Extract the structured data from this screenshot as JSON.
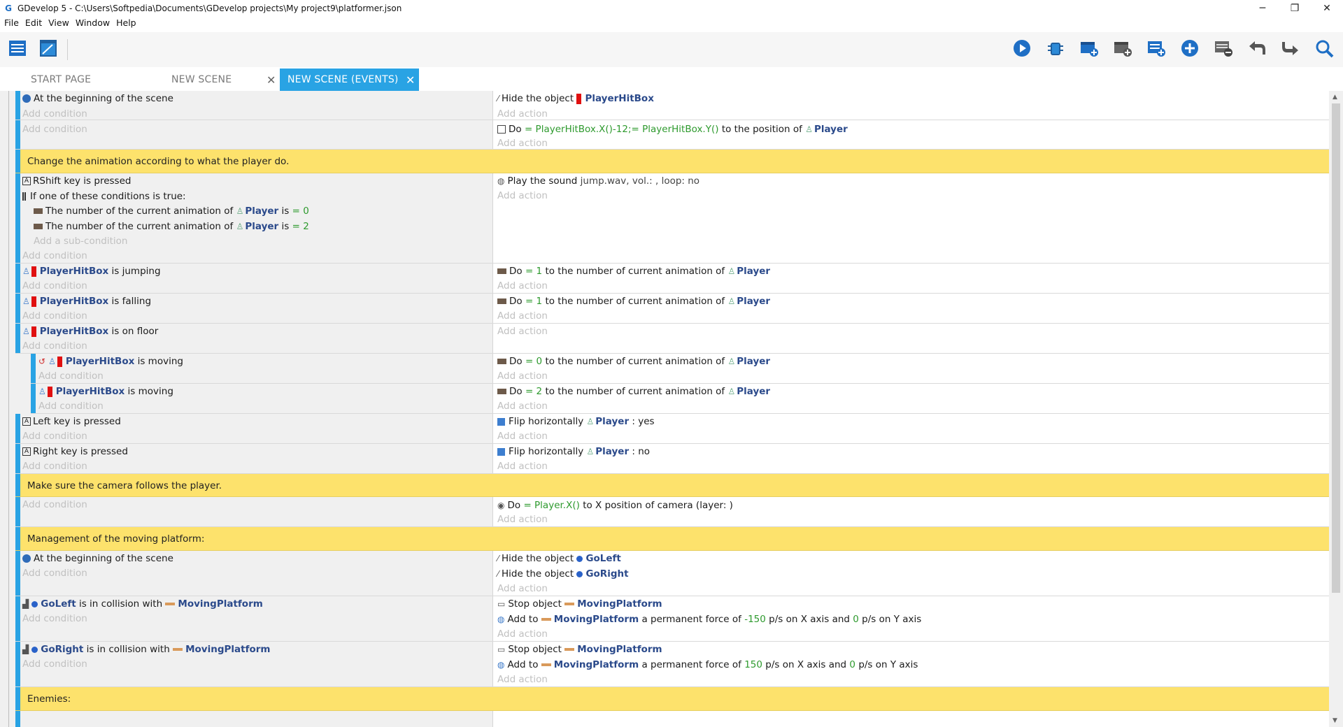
{
  "window": {
    "title": "GDevelop 5 - C:\\Users\\Softpedia\\Documents\\GDevelop projects\\My project9\\platformer.json",
    "controls": [
      "─",
      "❐",
      "✕"
    ]
  },
  "menu": [
    "File",
    "Edit",
    "View",
    "Window",
    "Help"
  ],
  "tabs": {
    "start": "START PAGE",
    "scene": "NEW SCENE",
    "events": "NEW SCENE (EVENTS)",
    "close": "✕"
  },
  "placeholders": {
    "add_condition": "Add condition",
    "add_action": "Add action",
    "add_subcondition": "Add a sub-condition"
  },
  "events": {
    "e1": {
      "cond": "At the beginning of the scene",
      "act_pre": "Hide the object",
      "act_obj": "PlayerHitBox"
    },
    "e2": {
      "act_do": "Do",
      "act_expr_x": "= PlayerHitBox.X()-12;",
      "act_expr_y": "= PlayerHitBox.Y()",
      "act_mid": "to the position of",
      "act_obj": "Player"
    },
    "c1": "Change the animation according to what the player do.",
    "e3": {
      "cond_a_key": "RShift",
      "cond_a_rest": "key is pressed",
      "cond_or": "If one of these conditions is true:",
      "sub1_pre": "The number of the current animation of",
      "sub1_obj": "Player",
      "sub1_op": "is",
      "sub1_val": "= 0",
      "sub2_pre": "The number of the current animation of",
      "sub2_obj": "Player",
      "sub2_op": "is",
      "sub2_val": "= 2",
      "act_pre": "Play the sound",
      "act_val": "jump.wav, vol.: , loop: no"
    },
    "e4": {
      "cond_obj": "PlayerHitBox",
      "cond_rest": "is jumping",
      "act_do": "Do",
      "act_val": "= 1",
      "act_mid": "to the number of current animation of",
      "act_obj": "Player"
    },
    "e5": {
      "cond_obj": "PlayerHitBox",
      "cond_rest": "is falling",
      "act_do": "Do",
      "act_val": "= 1",
      "act_mid": "to the number of current animation of",
      "act_obj": "Player"
    },
    "e6": {
      "cond_obj": "PlayerHitBox",
      "cond_rest": "is on floor"
    },
    "e6a": {
      "cond_obj": "PlayerHitBox",
      "cond_rest": "is moving",
      "act_do": "Do",
      "act_val": "= 0",
      "act_mid": "to the number of current animation of",
      "act_obj": "Player"
    },
    "e6b": {
      "cond_obj": "PlayerHitBox",
      "cond_rest": "is moving",
      "act_do": "Do",
      "act_val": "= 2",
      "act_mid": "to the number of current animation of",
      "act_obj": "Player"
    },
    "e7": {
      "cond": "Left key is pressed",
      "act_pre": "Flip horizontally",
      "act_obj": "Player",
      "act_val": ": yes"
    },
    "e8": {
      "cond": "Right key is pressed",
      "act_pre": "Flip horizontally",
      "act_obj": "Player",
      "act_val": ": no"
    },
    "c2": "Make sure the camera follows the player.",
    "e9": {
      "act_do": "Do",
      "act_expr": "= Player.X()",
      "act_mid": "to X position of camera",
      "act_tail": "(layer: )"
    },
    "c3": "Management of the moving platform:",
    "e10": {
      "cond": "At the beginning of the scene",
      "act1_pre": "Hide the object",
      "act1_obj": "GoLeft",
      "act2_pre": "Hide the object",
      "act2_obj": "GoRight"
    },
    "e11": {
      "cond_obj": "GoLeft",
      "cond_mid": "is in collision with",
      "cond_obj2": "MovingPlatform",
      "act1_pre": "Stop object",
      "act1_obj": "MovingPlatform",
      "act2_pre": "Add to",
      "act2_obj": "MovingPlatform",
      "act2_mid": "a permanent force of",
      "act2_x": "-150",
      "act2_mid2": "p/s on X axis and",
      "act2_y": "0",
      "act2_tail": "p/s on Y axis"
    },
    "e12": {
      "cond_obj": "GoRight",
      "cond_mid": "is in collision with",
      "cond_obj2": "MovingPlatform",
      "act1_pre": "Stop object",
      "act1_obj": "MovingPlatform",
      "act2_pre": "Add to",
      "act2_obj": "MovingPlatform",
      "act2_mid": "a permanent force of",
      "act2_x": "150",
      "act2_mid2": "p/s on X axis and",
      "act2_y": "0",
      "act2_tail": "p/s on Y axis"
    },
    "c4": "Enemies:"
  },
  "colors": {
    "accent": "#29a3e4",
    "comment": "#fde26c",
    "object": "#2b4a8b",
    "value": "#2e9a2e"
  }
}
